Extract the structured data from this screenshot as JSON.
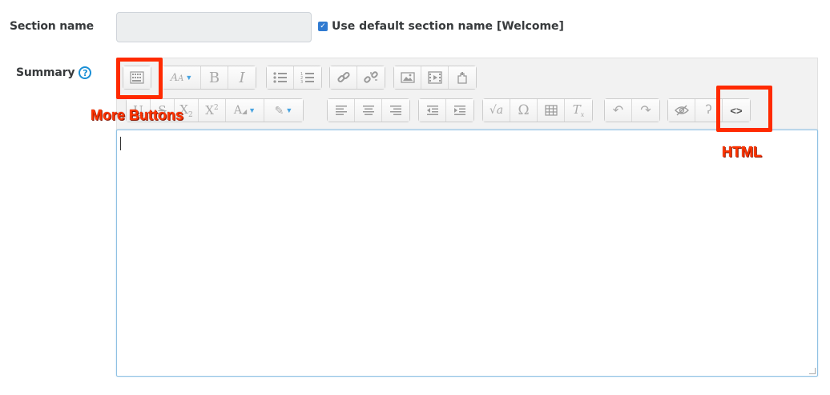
{
  "section": {
    "label": "Section name",
    "input_value": "",
    "checkbox_checked": true,
    "checkbox_label": "Use default section name [Welcome]"
  },
  "summary": {
    "label": "Summary",
    "help_icon": "question-circle-icon"
  },
  "toolbar": {
    "row1": [
      [
        "more-buttons-icon"
      ],
      [
        "font-style-dropdown-icon",
        "bold-icon",
        "italic-icon"
      ],
      [
        "unordered-list-icon",
        "ordered-list-icon"
      ],
      [
        "link-icon",
        "unlink-icon"
      ],
      [
        "image-icon",
        "media-icon",
        "manage-files-icon"
      ]
    ],
    "row2": [
      [
        "underline-icon",
        "strikethrough-icon",
        "subscript-icon",
        "superscript-icon",
        "font-color-icon",
        "background-color-icon"
      ],
      [
        "align-left-icon",
        "align-center-icon",
        "align-right-icon"
      ],
      [
        "outdent-icon",
        "indent-icon"
      ],
      [
        "equation-icon",
        "special-character-icon",
        "table-icon",
        "clear-formatting-icon"
      ],
      [
        "undo-icon",
        "redo-icon"
      ],
      [
        "accessibility-checker-icon",
        "screenreader-helper-icon",
        "html-icon"
      ]
    ]
  },
  "editor": {
    "content": ""
  },
  "annotations": {
    "more_buttons": "More Buttons",
    "html": "HTML"
  },
  "colors": {
    "annotation": "#ff2a00",
    "accent": "#1a8fd6"
  }
}
